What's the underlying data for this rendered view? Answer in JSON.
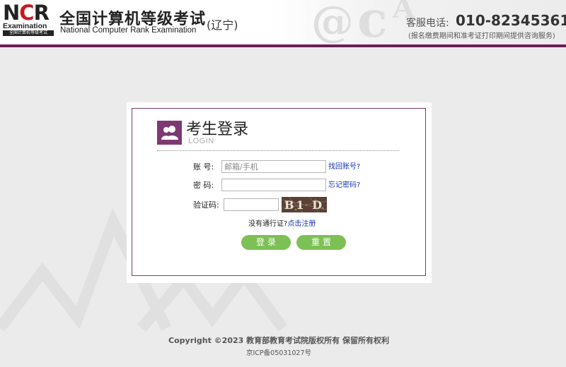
{
  "header": {
    "logo": {
      "letters": [
        "N",
        "C",
        "R"
      ],
      "examination": "Examination",
      "subtitle": "全国计算机等级考试"
    },
    "title": "全国计算机等级考试",
    "subtitle": "National Computer Rank Examination",
    "region": "(辽宁)",
    "service_label": "客服电话:",
    "service_phone": "010-82345361",
    "service_note": "(报名缴费期间和准考证打印期间提供咨询服务)",
    "accent_color": "#6b1f56"
  },
  "login": {
    "title": "考生登录",
    "subtitle": "LOGIN",
    "icon": "users-icon",
    "account": {
      "label": "账  号:",
      "placeholder": "邮箱/手机",
      "value": "",
      "link": "找回账号?"
    },
    "password": {
      "label": "密  码:",
      "value": "",
      "link": "忘记密码?"
    },
    "captcha": {
      "label": "验证码:",
      "value": "",
      "image_text": "B1 D"
    },
    "no_pass_text": "没有通行证?",
    "register_link": "点击注册",
    "login_button": "登录",
    "reset_button": "重置",
    "button_color": "#7dc055",
    "border_color": "#7e3a6a"
  },
  "footer": {
    "copyright": "Copyright ©2023 教育部教育考试院版权所有 保留所有权利",
    "icp": "京ICP备05031027号"
  }
}
